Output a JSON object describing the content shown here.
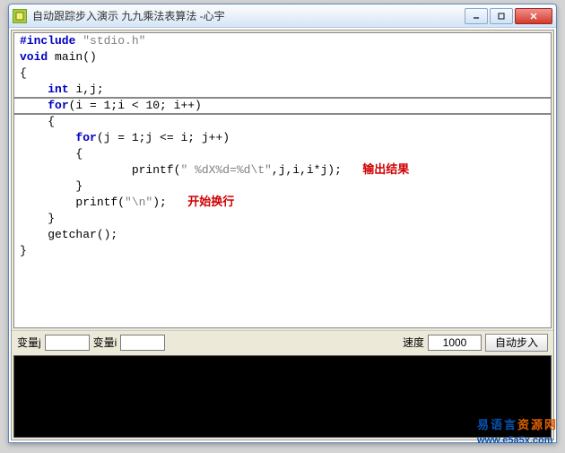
{
  "window": {
    "title": "自动跟踪步入演示 九九乘法表算法  -心宇"
  },
  "code": {
    "l1_kw": "#include",
    "l1_str": " \"stdio.h\"",
    "l2": "",
    "l3_kw": "void",
    "l3_rest": " main()",
    "l4": "{",
    "l5_a": "    ",
    "l5_kw": "int",
    "l5_b": " i,j;",
    "l6_a": "    ",
    "l6_kw": "for",
    "l6_b": "(i = 1;i < 10; i++)",
    "l7": "    {",
    "l8_a": "        ",
    "l8_kw": "for",
    "l8_b": "(j = 1;j <= i; j++)",
    "l9": "        {",
    "l10_a": "                printf(",
    "l10_str": "\" %dX%d=%d\\t\"",
    "l10_b": ",j,i,i*j);   ",
    "l10_ann": "输出结果",
    "l11": "        }",
    "l12_a": "        printf(",
    "l12_str": "\"\\n\"",
    "l12_b": ");   ",
    "l12_ann": "开始换行",
    "l13": "    }",
    "l14": "    getchar();",
    "l15": "}"
  },
  "controls": {
    "var_j_label": "变量j",
    "var_j_value": "",
    "var_i_label": "变量i",
    "var_i_value": "",
    "speed_label": "速度",
    "speed_value": "1000",
    "step_button": "自动步入"
  },
  "watermark": {
    "part1": "易语言",
    "part2": "资源网",
    "url": "www.e5a5x.com"
  }
}
